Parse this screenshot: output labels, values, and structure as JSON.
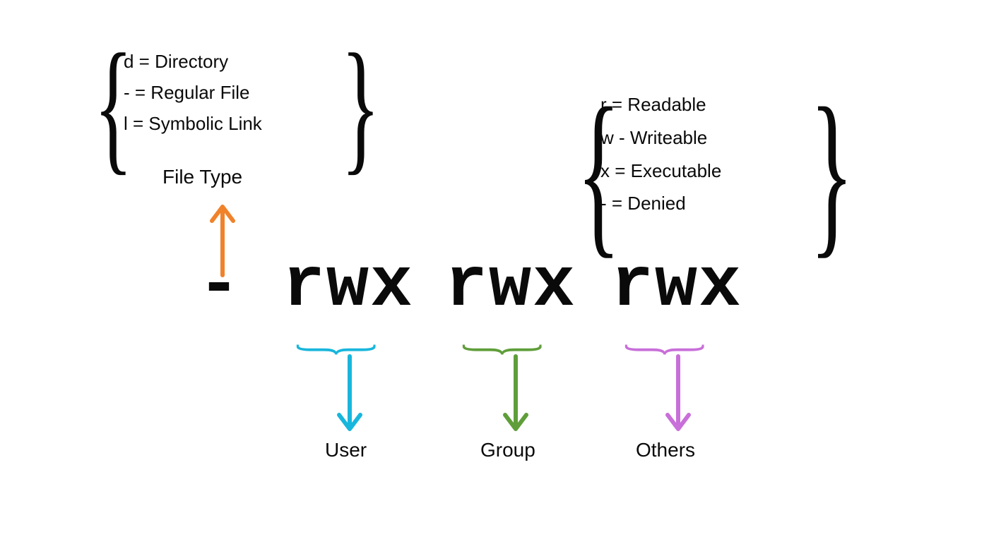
{
  "left_legend": {
    "items": [
      "d = Directory",
      "- = Regular File",
      "l = Symbolic Link"
    ],
    "title": "File Type"
  },
  "right_legend": {
    "items": [
      "r = Readable",
      "w - Writeable",
      "x = Executable",
      "- = Denied"
    ]
  },
  "permission_string": {
    "filetype_char": "-",
    "user": "rwx",
    "group": "rwx",
    "others": "rwx"
  },
  "labels": {
    "user": "User",
    "group": "Group",
    "others": "Others"
  },
  "colors": {
    "orange": "#f0822b",
    "blue": "#18b6dc",
    "green": "#5f9e3a",
    "purple": "#c86fd9"
  }
}
